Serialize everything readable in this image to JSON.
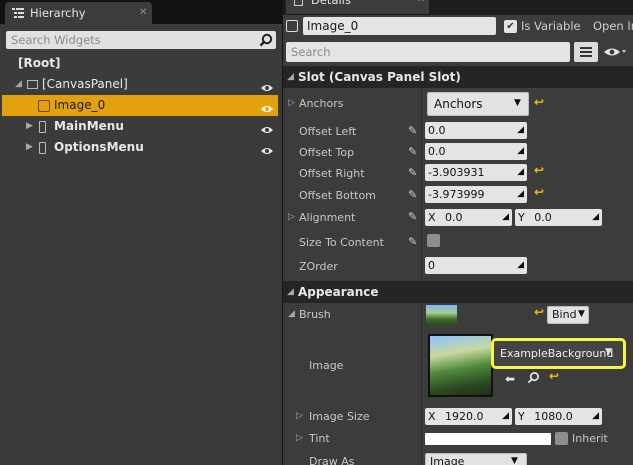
{
  "hierarchy": {
    "tab_title": "Hierarchy",
    "tab_close": "✕",
    "search_placeholder": "Search Widgets",
    "tree": [
      {
        "label": "[Root]",
        "expand": ""
      },
      {
        "label": "[CanvasPanel]",
        "expand": "◢"
      },
      {
        "label": "Image_0",
        "expand": ""
      },
      {
        "label": "MainMenu",
        "expand": "▶"
      },
      {
        "label": "OptionsMenu",
        "expand": "▶"
      }
    ]
  },
  "details": {
    "tab_title": "Details",
    "tab_close": "✕",
    "widget_name": "Image_0",
    "is_variable_label": "Is Variable",
    "is_variable_checked": true,
    "open_label": "Open Ir",
    "search_placeholder": "Search",
    "slot": {
      "header": "Slot (Canvas Panel Slot)",
      "anchors_label": "Anchors",
      "anchors_value": "Anchors",
      "offset_left_label": "Offset Left",
      "offset_left": "0.0",
      "offset_top_label": "Offset Top",
      "offset_top": "0.0",
      "offset_right_label": "Offset Right",
      "offset_right": "-3.903931",
      "offset_bottom_label": "Offset Bottom",
      "offset_bottom": "-3.973999",
      "alignment_label": "Alignment",
      "alignment_x": "0.0",
      "alignment_y": "0.0",
      "size_to_content_label": "Size To Content",
      "zorder_label": "ZOrder",
      "zorder": "0"
    },
    "appearance": {
      "header": "Appearance",
      "brush_label": "Brush",
      "bind_label": "Bind",
      "image_label": "Image",
      "image_value": "ExampleBackground",
      "image_size_label": "Image Size",
      "image_size_x": "1920.0",
      "image_size_y": "1080.0",
      "tint_label": "Tint",
      "inherit_label": "Inherit",
      "draw_as_label": "Draw As",
      "draw_as_value": "Image"
    },
    "axis_x": "X",
    "axis_y": "Y"
  },
  "colors": {
    "selection": "#e1a20e",
    "highlight_outline": "#f5f542",
    "reset_arrow": "#f2c20f"
  }
}
